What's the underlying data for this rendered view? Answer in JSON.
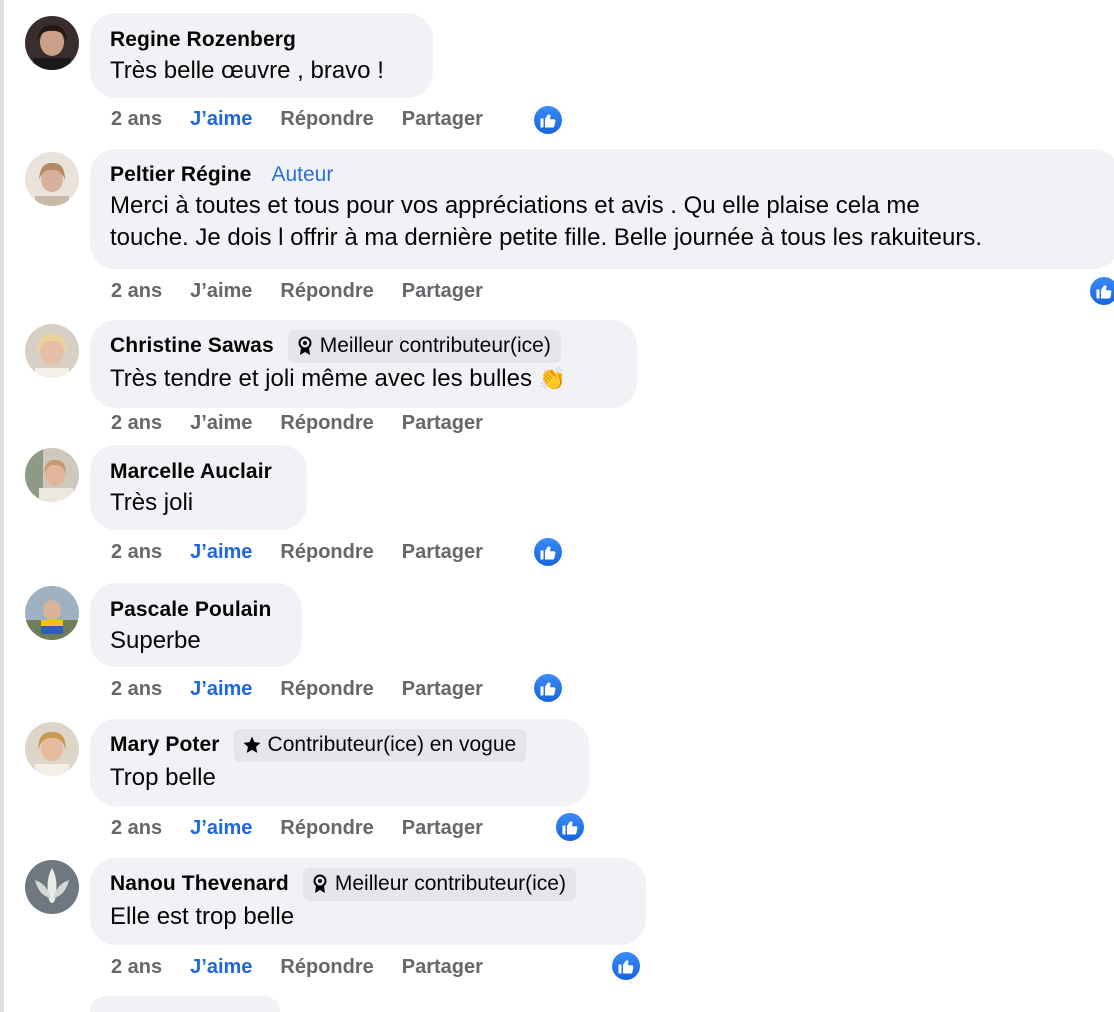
{
  "comments": [
    {
      "author": "Regine Rozenberg",
      "text": "Très belle œuvre , bravo !",
      "time": "2 ans",
      "like_label": "J’aime",
      "reply_label": "Répondre",
      "share_label": "Partager",
      "liked": true,
      "avatar_icon": "avatar-photo"
    },
    {
      "author": "Peltier Régine",
      "tag": "Auteur",
      "text_line1": "Merci à toutes et tous pour vos appréciations et avis . Qu elle plaise cela me",
      "text_line2": "touche. Je dois l offrir à ma dernière petite fille. Belle journée à tous les rakuiteurs.",
      "time": "2 ans",
      "like_label": "J’aime",
      "reply_label": "Répondre",
      "share_label": "Partager",
      "liked": false,
      "avatar_icon": "avatar-photo"
    },
    {
      "author": "Christine Sawas",
      "badge": "Meilleur contributeur(ice)",
      "badge_icon": "award-ribbon-icon",
      "text": "Très tendre et joli même avec les bulles",
      "emoji": "👏",
      "time": "2 ans",
      "like_label": "J’aime",
      "reply_label": "Répondre",
      "share_label": "Partager",
      "liked": false,
      "avatar_icon": "avatar-photo"
    },
    {
      "author": "Marcelle Auclair",
      "text": "Très joli",
      "time": "2 ans",
      "like_label": "J’aime",
      "reply_label": "Répondre",
      "share_label": "Partager",
      "liked": true,
      "avatar_icon": "avatar-photo"
    },
    {
      "author": "Pascale Poulain",
      "text": "Superbe",
      "time": "2 ans",
      "like_label": "J’aime",
      "reply_label": "Répondre",
      "share_label": "Partager",
      "liked": true,
      "avatar_icon": "avatar-photo"
    },
    {
      "author": "Mary Poter",
      "badge": "Contributeur(ice) en vogue",
      "badge_icon": "star-icon",
      "text": "Trop belle",
      "time": "2 ans",
      "like_label": "J’aime",
      "reply_label": "Répondre",
      "share_label": "Partager",
      "liked": true,
      "avatar_icon": "avatar-photo"
    },
    {
      "author": "Nanou Thevenard",
      "badge": "Meilleur contributeur(ice)",
      "badge_icon": "award-ribbon-icon",
      "text": "Elle est trop belle",
      "time": "2 ans",
      "like_label": "J’aime",
      "reply_label": "Répondre",
      "share_label": "Partager",
      "liked": true,
      "avatar_icon": "avatar-photo"
    }
  ],
  "colors": {
    "bubble": "#f0f2f5",
    "liked_link": "#1f66e0",
    "muted": "#65676b",
    "like_badge": "#1877f2",
    "badge_bg": "#e4e6eb"
  }
}
